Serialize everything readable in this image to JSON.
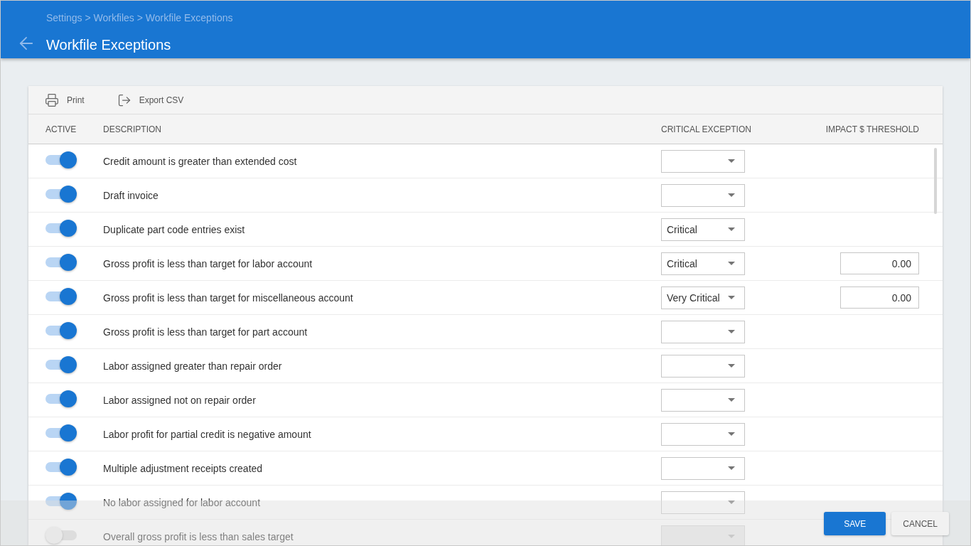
{
  "header": {
    "breadcrumb": "Settings > Workfiles > Workfile Exceptions",
    "title": "Workfile Exceptions"
  },
  "toolbar": [
    {
      "kind": "print",
      "label": "Print"
    },
    {
      "kind": "export",
      "label": "Export CSV"
    }
  ],
  "table": {
    "columns": [
      "ACTIVE",
      "DESCRIPTION",
      "CRITICAL EXCEPTION",
      "IMPACT $ THRESHOLD"
    ],
    "rows": [
      {
        "active": true,
        "description": "Credit amount is greater than extended cost"
      },
      {
        "active": true,
        "description": "Draft invoice"
      },
      {
        "active": true,
        "description": "Duplicate part code entries exist",
        "critical_exception": "Critical"
      },
      {
        "active": true,
        "description": "Gross profit is less than target for labor account",
        "critical_exception": "Critical",
        "impact_threshold": "0.00"
      },
      {
        "active": true,
        "description": "Gross profit is less than target for miscellaneous account",
        "critical_exception": "Very Critical",
        "impact_threshold": "0.00"
      },
      {
        "active": true,
        "description": "Gross profit is less than target for part account"
      },
      {
        "active": true,
        "description": "Labor assigned greater than repair order"
      },
      {
        "active": true,
        "description": "Labor assigned not on repair order"
      },
      {
        "active": true,
        "description": "Labor profit for partial credit is negative amount"
      },
      {
        "active": true,
        "description": "Multiple adjustment receipts created"
      },
      {
        "active": true,
        "description": "No labor assigned for labor account"
      },
      {
        "active": false,
        "description": "Overall gross profit is less than sales target"
      }
    ]
  },
  "footer": {
    "buttons": [
      {
        "kind": "primary",
        "label": "SAVE"
      },
      {
        "kind": "secondary",
        "label": "CANCEL"
      }
    ]
  }
}
